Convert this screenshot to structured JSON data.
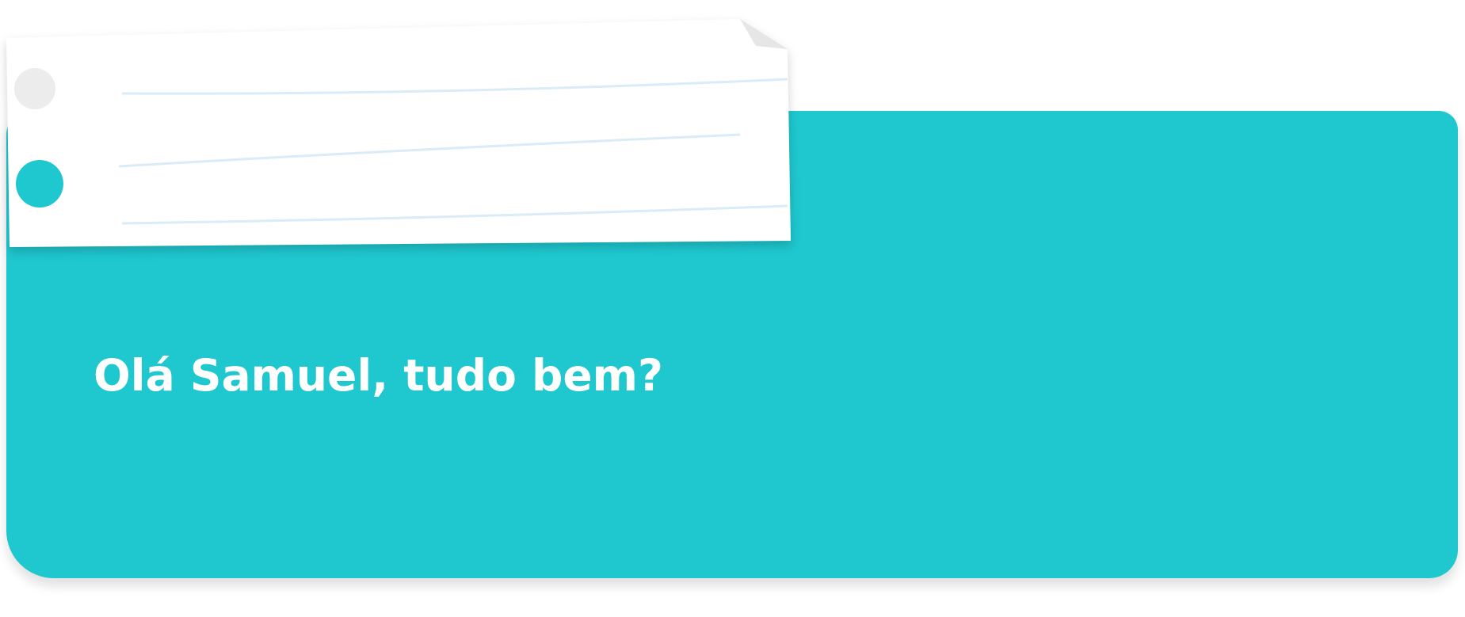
{
  "greeting": {
    "text": "Olá Samuel, tudo bem?"
  },
  "colors": {
    "card": "#1fc7cf",
    "paper": "#ffffff",
    "paper_lines": "#d9ecf7",
    "text": "#ffffff"
  }
}
